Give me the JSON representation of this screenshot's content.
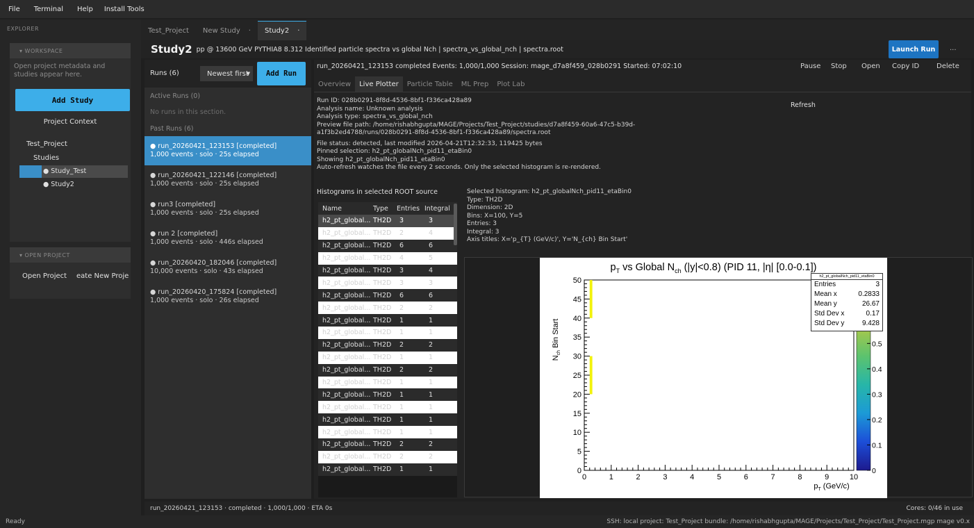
{
  "menu": [
    "File",
    "Terminal",
    "Help",
    "Install Tools"
  ],
  "explorer": {
    "title": "EXPLORER",
    "workspace_header": "▾  WORKSPACE",
    "workspace_msg": "Open project metadata and studies appear here.",
    "add_study": "Add Study",
    "project_context": "Project Context",
    "tree": {
      "project": "Test_Project",
      "studies": "Studies",
      "study_test": "● Study_Test",
      "study2": "● Study2"
    },
    "open_project_header": "▾  OPEN PROJECT",
    "open_project": "Open Project",
    "create_project": "eate New Proje"
  },
  "top_tabs": [
    {
      "label": "Test_Project",
      "close": ""
    },
    {
      "label": "New Study",
      "close": "·"
    },
    {
      "label": "Study2",
      "close": "·"
    }
  ],
  "study_header": {
    "title": "Study2",
    "subtitle": "pp @ 13600 GeV  PYTHIA8 8.312  Identified particle spectra vs global Nch | spectra_vs_global_nch | spectra.root",
    "launch": "Launch Run",
    "more": "..."
  },
  "runs": {
    "count": "Runs (6)",
    "sort": "Newest first",
    "add_run": "Add Run",
    "active_header": "Active Runs (0)",
    "no_runs": "No runs in this section.",
    "past_header": "Past Runs (6)",
    "items": [
      {
        "title": "● run_20260421_123153   [completed]",
        "meta": "1,000 events · solo · 25s elapsed"
      },
      {
        "title": "● run_20260421_122146   [completed]",
        "meta": "1,000 events · solo · 25s elapsed"
      },
      {
        "title": "● run3   [completed]",
        "meta": "1,000 events · solo · 25s elapsed"
      },
      {
        "title": "● run 2   [completed]",
        "meta": "1,000 events · solo · 446s elapsed"
      },
      {
        "title": "● run_20260420_182046   [completed]",
        "meta": "10,000 events · solo · 43s elapsed"
      },
      {
        "title": "● run_20260420_175824   [completed]",
        "meta": "1,000 events · solo · 26s elapsed"
      }
    ]
  },
  "run_header": {
    "text": "run_20260421_123153  completed  Events: 1,000/1,000  Session: mage_d7a8f459_028b0291  Started: 07:02:10",
    "actions": [
      "Pause",
      "Stop",
      "Open",
      "Copy ID",
      "Delete"
    ]
  },
  "sub_tabs": [
    "Overview",
    "Live Plotter",
    "Particle Table",
    "ML Prep",
    "Plot Lab"
  ],
  "info": {
    "run_id": "Run ID: 028b0291-8f8d-4536-8bf1-f336ca428a89",
    "analysis_name": "Analysis name: Unknown analysis",
    "analysis_type": "Analysis type: spectra_vs_global_nch",
    "preview_path_1": "Preview file path: /home/rishabhgupta/MAGE/Projects/Test_Project/studies/d7a8f459-60a6-47c5-b39d-",
    "preview_path_2": "a1f3b2ed4788/runs/028b0291-8f8d-4536-8bf1-f336ca428a89/spectra.root",
    "file_status": "File status: detected, last modified 2026-04-21T12:32:33, 119425 bytes",
    "pinned": "Pinned selection: h2_pt_globalNch_pid11_etaBin0",
    "showing": "Showing h2_pt_globalNch_pid11_etaBin0",
    "auto": "Auto-refresh watches the file every 2 seconds. Only the selected histogram is re-rendered.",
    "refresh": "Refresh"
  },
  "hist_list": {
    "title": "Histograms in selected ROOT source",
    "headers": [
      "Name",
      "Type",
      "Entries",
      "Integral"
    ],
    "rows": [
      [
        "h2_pt_global...",
        "TH2D",
        "3",
        "3"
      ],
      [
        "h2_pt_global...",
        "TH2D",
        "2",
        "4"
      ],
      [
        "h2_pt_global...",
        "TH2D",
        "6",
        "6"
      ],
      [
        "h2_pt_global...",
        "TH2D",
        "4",
        "5"
      ],
      [
        "h2_pt_global...",
        "TH2D",
        "3",
        "4"
      ],
      [
        "h2_pt_global...",
        "TH2D",
        "3",
        "3"
      ],
      [
        "h2_pt_global...",
        "TH2D",
        "6",
        "6"
      ],
      [
        "h2_pt_global...",
        "TH2D",
        "2",
        "2"
      ],
      [
        "h2_pt_global...",
        "TH2D",
        "1",
        "1"
      ],
      [
        "h2_pt_global...",
        "TH2D",
        "1",
        "1"
      ],
      [
        "h2_pt_global...",
        "TH2D",
        "2",
        "2"
      ],
      [
        "h2_pt_global...",
        "TH2D",
        "1",
        "1"
      ],
      [
        "h2_pt_global...",
        "TH2D",
        "2",
        "2"
      ],
      [
        "h2_pt_global...",
        "TH2D",
        "1",
        "1"
      ],
      [
        "h2_pt_global...",
        "TH2D",
        "1",
        "1"
      ],
      [
        "h2_pt_global...",
        "TH2D",
        "1",
        "1"
      ],
      [
        "h2_pt_global...",
        "TH2D",
        "1",
        "1"
      ],
      [
        "h2_pt_global...",
        "TH2D",
        "1",
        "1"
      ],
      [
        "h2_pt_global...",
        "TH2D",
        "2",
        "2"
      ],
      [
        "h2_pt_global...",
        "TH2D",
        "2",
        "2"
      ],
      [
        "h2_pt_global...",
        "TH2D",
        "1",
        "1"
      ]
    ]
  },
  "selected": {
    "title": "Selected histogram: h2_pt_globalNch_pid11_etaBin0",
    "type": "Type: TH2D",
    "dim": "Dimension: 2D",
    "bins": "Bins: X=100, Y=5",
    "entries": "Entries: 3",
    "integral": "Integral: 3",
    "axis": "Axis titles: X='p_{T} (GeV/c)', Y='N_{ch} Bin Start'"
  },
  "plot": {
    "stats_title": "h2_pt_globalNch_pid11_etaBin0",
    "stats": [
      [
        "Entries",
        "3"
      ],
      [
        "Mean x",
        "0.2833"
      ],
      [
        "Mean y",
        "26.67"
      ],
      [
        "Std Dev x",
        "0.17"
      ],
      [
        "Std Dev y",
        "9.428"
      ]
    ]
  },
  "chart_data": {
    "type": "heatmap",
    "title": "pT vs Global Nch (|y|<0.8) (PID 11, |η| [0.0-0.1])",
    "xlabel": "pT (GeV/c)",
    "ylabel": "Nch Bin Start",
    "xlim": [
      0,
      10
    ],
    "ylim": [
      0,
      50
    ],
    "x_ticks": [
      "0",
      "1",
      "2",
      "3",
      "4",
      "5",
      "6",
      "7",
      "8",
      "9",
      "10"
    ],
    "y_ticks": [
      "0",
      "5",
      "10",
      "15",
      "20",
      "25",
      "30",
      "35",
      "40",
      "45",
      "50"
    ],
    "z_ticks": [
      "0",
      "0.1",
      "0.2",
      "0.3",
      "0.4",
      "0.5",
      "0.6",
      "0.7"
    ],
    "cells": [
      {
        "x0": 0.2,
        "x1": 0.3,
        "y0": 20,
        "y1": 30,
        "z": 2
      },
      {
        "x0": 0.2,
        "x1": 0.3,
        "y0": 40,
        "y1": 50,
        "z": 1
      }
    ]
  },
  "bottom": {
    "run_status": "run_20260421_123153 · completed · 1,000/1,000 · ETA 0s",
    "cores": "Cores: 0/46 in use"
  },
  "status": {
    "left": "Ready",
    "right": "SSH: local   project: Test_Project   bundle: /home/rishabhgupta/MAGE/Projects/Test_Project/Test_Project.mgp   mage v0.x"
  }
}
